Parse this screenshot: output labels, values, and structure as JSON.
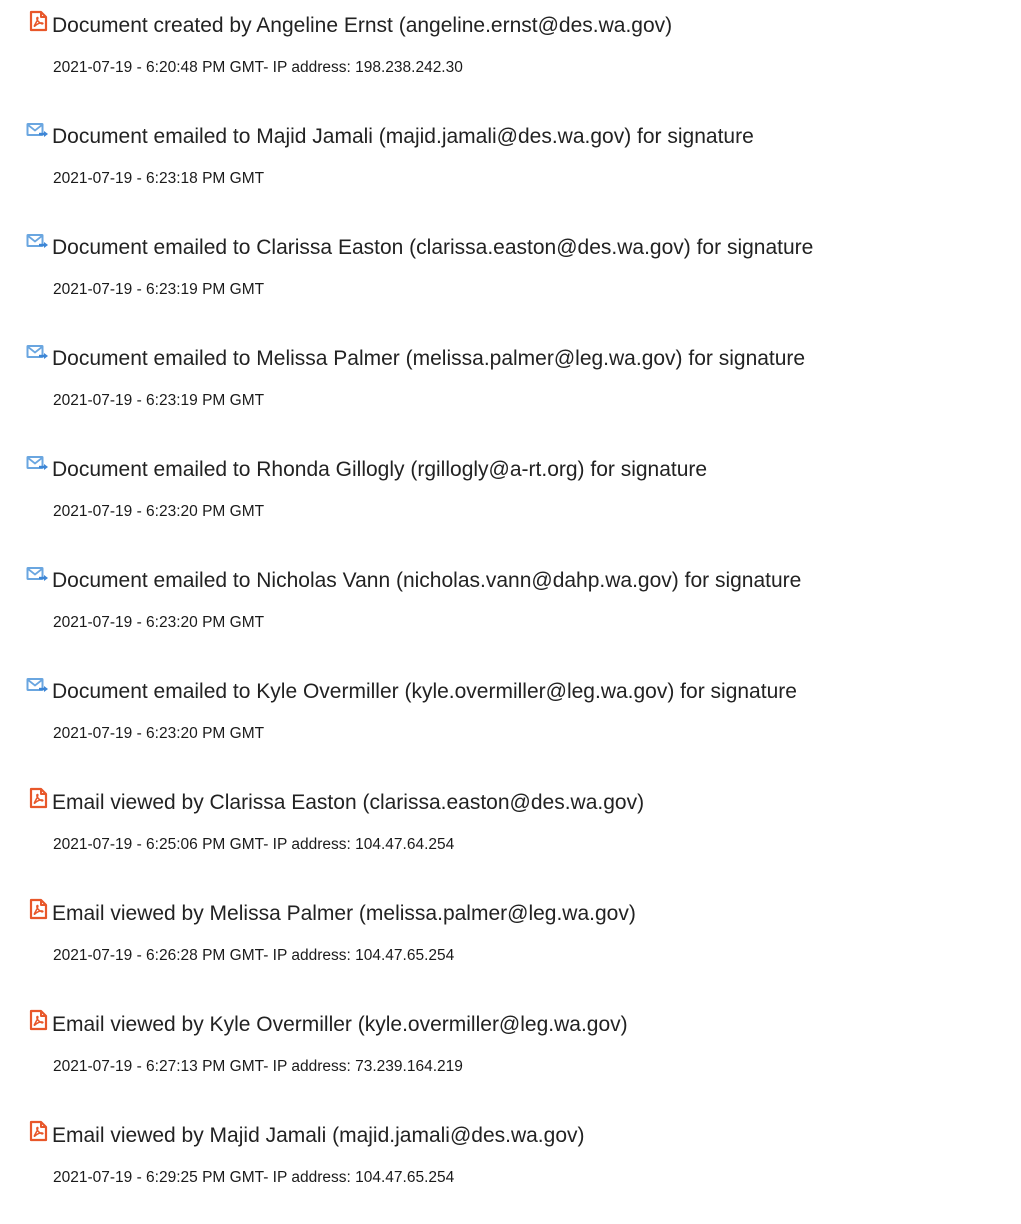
{
  "icons": {
    "document": "acrobat-document-icon",
    "email": "email-forward-icon"
  },
  "colors": {
    "document_icon": "#e8572a",
    "email_icon": "#6aa6e0",
    "email_arrow": "#3d86d6",
    "text": "#222222"
  },
  "entries": [
    {
      "icon": "document",
      "title": "Document created by Angeline Ernst (angeline.ernst@des.wa.gov)",
      "timestamp": "2021-07-19 - 6:20:48 PM GMT- IP address: 198.238.242.30"
    },
    {
      "icon": "email",
      "title": "Document emailed to Majid Jamali (majid.jamali@des.wa.gov) for signature",
      "timestamp": "2021-07-19 - 6:23:18 PM GMT"
    },
    {
      "icon": "email",
      "title": "Document emailed to Clarissa Easton (clarissa.easton@des.wa.gov) for signature",
      "timestamp": "2021-07-19 - 6:23:19 PM GMT"
    },
    {
      "icon": "email",
      "title": "Document emailed to Melissa Palmer (melissa.palmer@leg.wa.gov) for signature",
      "timestamp": "2021-07-19 - 6:23:19 PM GMT"
    },
    {
      "icon": "email",
      "title": "Document emailed to Rhonda Gillogly (rgillogly@a-rt.org) for signature",
      "timestamp": "2021-07-19 - 6:23:20 PM GMT"
    },
    {
      "icon": "email",
      "title": "Document emailed to Nicholas Vann (nicholas.vann@dahp.wa.gov) for signature",
      "timestamp": "2021-07-19 - 6:23:20 PM GMT"
    },
    {
      "icon": "email",
      "title": "Document emailed to Kyle Overmiller (kyle.overmiller@leg.wa.gov) for signature",
      "timestamp": "2021-07-19 - 6:23:20 PM GMT"
    },
    {
      "icon": "document",
      "title": "Email viewed by Clarissa Easton (clarissa.easton@des.wa.gov)",
      "timestamp": "2021-07-19 - 6:25:06 PM GMT- IP address: 104.47.64.254"
    },
    {
      "icon": "document",
      "title": "Email viewed by Melissa Palmer (melissa.palmer@leg.wa.gov)",
      "timestamp": "2021-07-19 - 6:26:28 PM GMT- IP address: 104.47.65.254"
    },
    {
      "icon": "document",
      "title": "Email viewed by Kyle Overmiller (kyle.overmiller@leg.wa.gov)",
      "timestamp": "2021-07-19 - 6:27:13 PM GMT- IP address: 73.239.164.219"
    },
    {
      "icon": "document",
      "title": "Email viewed by Majid Jamali (majid.jamali@des.wa.gov)",
      "timestamp": "2021-07-19 - 6:29:25 PM GMT- IP address: 104.47.65.254"
    }
  ]
}
